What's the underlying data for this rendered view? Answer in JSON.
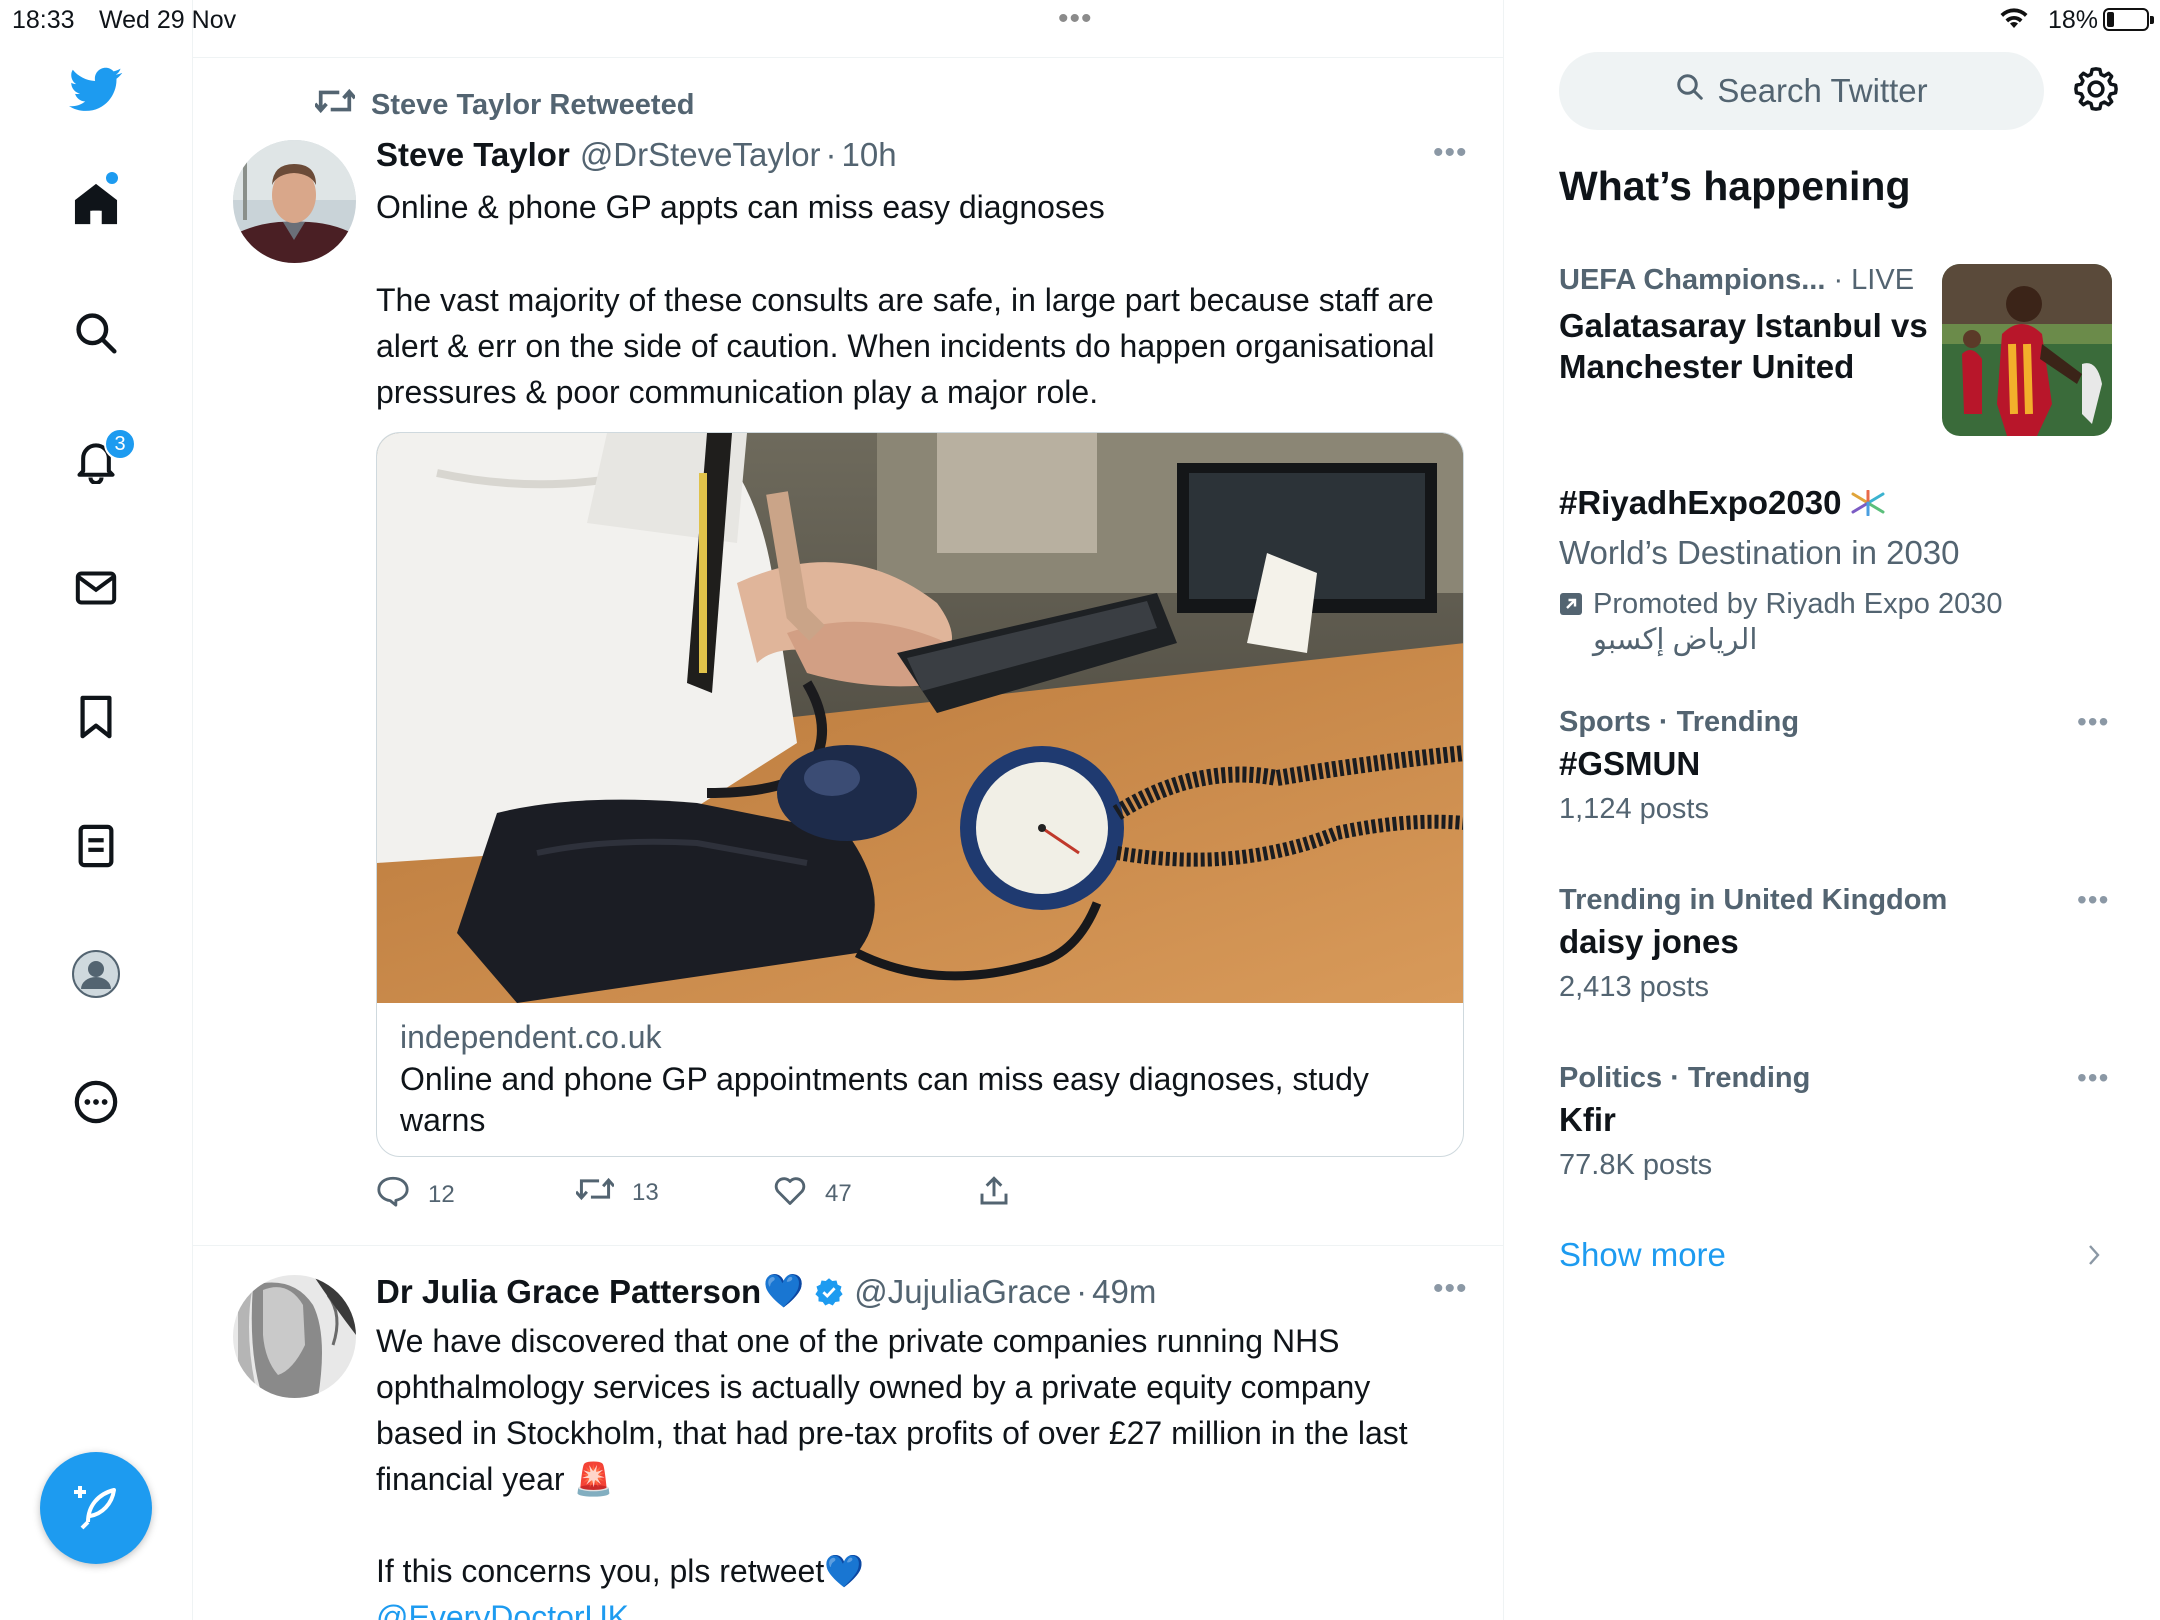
{
  "status_bar": {
    "time": "18:33",
    "date": "Wed 29 Nov",
    "battery": "18%"
  },
  "nav": {
    "notifications_badge": "3",
    "icons": [
      "twitter-bird-icon",
      "home-icon",
      "search-icon",
      "bell-icon",
      "mail-icon",
      "bookmark-icon",
      "lists-icon",
      "profile-icon",
      "more-icon",
      "compose-icon"
    ]
  },
  "timeline": {
    "tweets": [
      {
        "retweeted_by": "Steve Taylor Retweeted",
        "name": "Steve Taylor",
        "handle": "@DrSteveTaylor",
        "separator": "·",
        "time": "10h",
        "text_line1": "Online & phone GP appts can miss easy diagnoses",
        "text_para2": "The vast majority of these consults are safe, in large part because staff are alert & err on the side of caution. When incidents do happen organisational pressures & poor communication play a major role.",
        "card": {
          "domain": "independent.co.uk",
          "title": "Online and phone GP appointments can miss easy diagnoses, study warns"
        },
        "replies": "12",
        "retweets": "13",
        "likes": "47"
      },
      {
        "name": "Dr Julia Grace Patterson",
        "name_emoji": "💙",
        "handle": "@JujuliaGrace",
        "separator": "·",
        "time": "49m",
        "text_para1": "We have discovered that one of the private companies running NHS ophthalmology services is actually owned by a private equity company based in Stockholm, that had pre-tax profits of over £27 million in the last financial year",
        "text_para1_emoji": "🚨",
        "text_para2": "If this concerns you, pls retweet",
        "text_para2_emoji": "💙",
        "mention": "@EveryDoctorUK"
      }
    ]
  },
  "sidebar": {
    "search_placeholder": "Search Twitter",
    "whats_happening": "What’s happening",
    "trends": [
      {
        "category": "UEFA Champions...",
        "status": " · LIVE",
        "name": "Galatasaray Istanbul vs Manchester United"
      },
      {
        "name": "#RiyadhExpo2030",
        "description": "World’s Destination in 2030",
        "promoted_by": "Promoted by Riyadh Expo 2030",
        "promoted_by_arabic": "الرياض إكسبو"
      },
      {
        "category": "Sports · Trending",
        "name": "#GSMUN",
        "count": "1,124 posts"
      },
      {
        "category": "Trending in United Kingdom",
        "name": "daisy jones",
        "count": "2,413 posts"
      },
      {
        "category": "Politics · Trending",
        "name": "Kfir",
        "count": "77.8K posts"
      }
    ],
    "show_more": "Show more"
  },
  "colors": {
    "accent": "#1d9bf0",
    "text": "#0f1419",
    "secondary": "#536471",
    "border": "#eff3f4"
  }
}
